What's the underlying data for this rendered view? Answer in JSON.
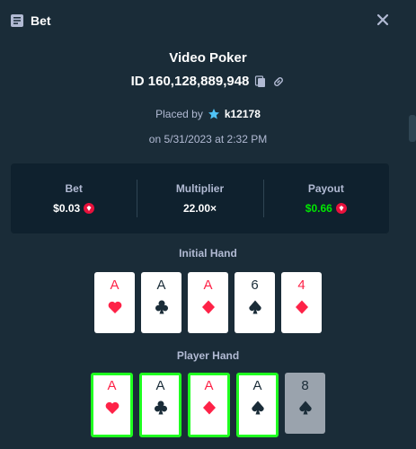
{
  "header": {
    "title": "Bet",
    "icon": "bet-slip-icon",
    "close_icon": "close-icon"
  },
  "game": {
    "title": "Video Poker",
    "bet_id": "ID 160,128,889,948"
  },
  "placed": {
    "prefix": "Placed by",
    "username": "k12178",
    "date": "on 5/31/2023 at 2:32 PM"
  },
  "stats": {
    "bet_label": "Bet",
    "bet_value": "$0.03",
    "multiplier_label": "Multiplier",
    "multiplier_value": "22.00×",
    "payout_label": "Payout",
    "payout_value": "$0.66"
  },
  "colors": {
    "background": "#1a2c38",
    "panel": "#0f212e",
    "payout": "#00e701",
    "held_border": "#1fff20",
    "red_suit": "#fe2247"
  },
  "initial_hand": {
    "title": "Initial Hand",
    "cards": [
      {
        "rank": "A",
        "suit": "hearts"
      },
      {
        "rank": "A",
        "suit": "clubs"
      },
      {
        "rank": "A",
        "suit": "diamonds"
      },
      {
        "rank": "6",
        "suit": "spades"
      },
      {
        "rank": "4",
        "suit": "diamonds"
      }
    ]
  },
  "player_hand": {
    "title": "Player Hand",
    "cards": [
      {
        "rank": "A",
        "suit": "hearts",
        "held": true
      },
      {
        "rank": "A",
        "suit": "clubs",
        "held": true
      },
      {
        "rank": "A",
        "suit": "diamonds",
        "held": true
      },
      {
        "rank": "A",
        "suit": "spades",
        "held": true
      },
      {
        "rank": "8",
        "suit": "spades",
        "held": false
      }
    ]
  }
}
